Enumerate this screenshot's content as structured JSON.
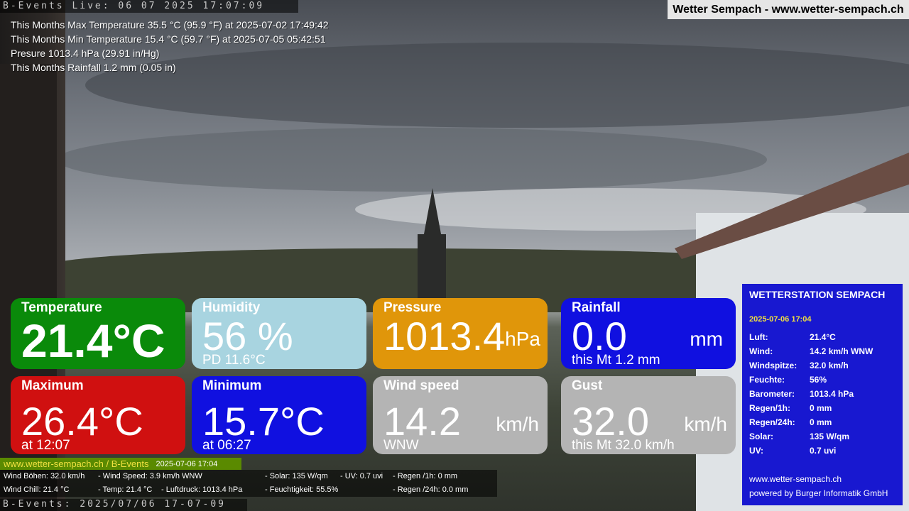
{
  "top_stamp": "B-Events Live: 06 07 2025 17:07:09",
  "site_title": "Wetter Sempach - www.wetter-sempach.ch",
  "stats": [
    "This Months Max Temperature 35.5 °C (95.9 °F) at 2025-07-02 17:49:42",
    "This Months Min Temperature 15.4 °C (59.7 °F) at 2025-07-05 05:42:51",
    "Presure 1013.4 hPa (29.91 in/Hg)",
    "This Months Rainfall 1.2 mm (0.05 in)"
  ],
  "tiles": {
    "temperature": {
      "label": "Temperature",
      "value": "21.4°C",
      "color": "#0a8a0a"
    },
    "humidity": {
      "label": "Humidity",
      "value": "56 %",
      "sub": "PD 11.6°C",
      "color": "#a8d4e0"
    },
    "pressure": {
      "label": "Pressure",
      "value": "1013.4",
      "unit": "hPa",
      "color": "#e0960a"
    },
    "rainfall": {
      "label": "Rainfall",
      "value": "0.0",
      "unit": "mm",
      "sub": "this Mt 1.2 mm",
      "color": "#1010e0"
    },
    "maximum": {
      "label": "Maximum",
      "value": "26.4°C",
      "sub": "at 12:07",
      "color": "#d01010"
    },
    "minimum": {
      "label": "Minimum",
      "value": "15.7°C",
      "sub": "at 06:27",
      "color": "#1010e0"
    },
    "wind_speed": {
      "label": "Wind speed",
      "value": "14.2",
      "unit": "km/h",
      "sub": "WNW",
      "color": "#b4b4b4"
    },
    "gust": {
      "label": "Gust",
      "value": "32.0",
      "unit": "km/h",
      "sub": "this Mt 32.0 km/h",
      "color": "#b4b4b4"
    }
  },
  "green_bar": {
    "site": "www.wetter-sempach.ch / B-Events",
    "timestamp": "2025-07-06 17:04"
  },
  "info_bar": {
    "wind_gusts": "Wind Böhen: 32.0 km/h",
    "wind_speed": "- Wind Speed: 3.9 km/h WNW",
    "solar": "- Solar: 135 W/qm",
    "uv": "- UV: 0.7 uvi",
    "rain_1h": "- Regen /1h:   0 mm",
    "wind_chill": "Wind Chill: 21.4 °C",
    "temp": "- Temp: 21.4 °C",
    "pressure": "- Luftdruck: 1013.4 hPa",
    "humidity": "- Feuchtigkeit: 55.5%",
    "rain_24h": "- Regen /24h: 0.0 mm"
  },
  "bottom_stamp": "B-Events: 2025/07/06 17-07-09",
  "station": {
    "title": "WETTERSTATION SEMPACH",
    "date": "2025-07-06 17:04",
    "rows": [
      {
        "label": "Luft:",
        "value": "21.4°C"
      },
      {
        "label": "Wind:",
        "value": "14.2 km/h  WNW"
      },
      {
        "label": "Windspitze:",
        "value": "32.0 km/h"
      },
      {
        "label": "Feuchte:",
        "value": "56%"
      },
      {
        "label": "Barometer:",
        "value": "1013.4 hPa"
      },
      {
        "label": "Regen/1h:",
        "value": "0 mm"
      },
      {
        "label": "Regen/24h:",
        "value": "0 mm"
      },
      {
        "label": "Solar:",
        "value": "135 W/qm"
      },
      {
        "label": "UV:",
        "value": "0.7 uvi"
      }
    ],
    "site": "www.wetter-sempach.ch",
    "powered": "powered by Burger Informatik GmbH"
  }
}
